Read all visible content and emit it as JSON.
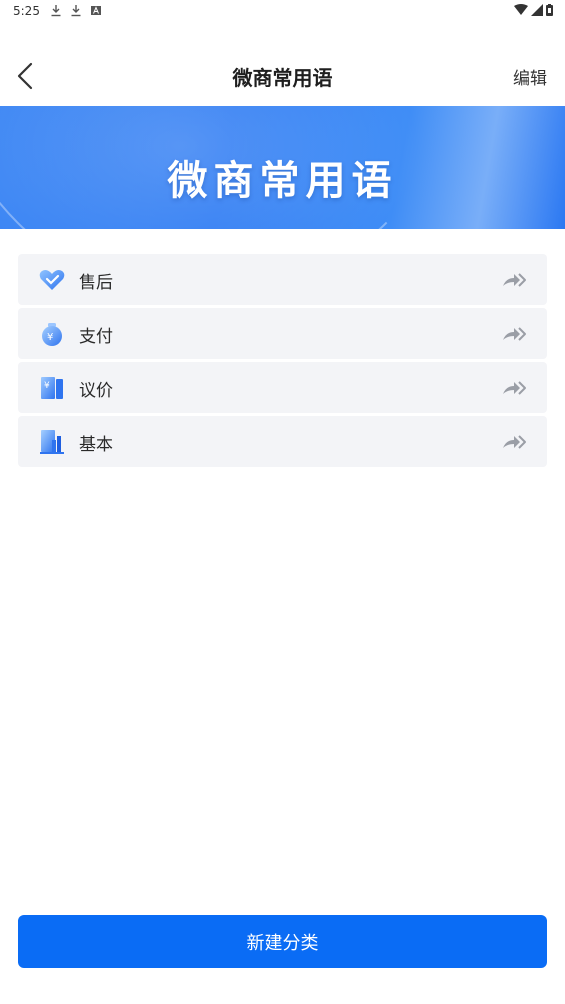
{
  "status_bar": {
    "time": "5:25",
    "left_icons": [
      "download-icon",
      "download-icon",
      "a-box-icon"
    ],
    "right_icons": [
      "wifi-icon",
      "signal-icon",
      "battery-icon"
    ]
  },
  "header": {
    "back_icon": "chevron-left-icon",
    "title": "微商常用语",
    "edit_label": "编辑"
  },
  "banner": {
    "title": "微商常用语"
  },
  "categories": [
    {
      "label": "售后",
      "icon": "heart-check-icon"
    },
    {
      "label": "支付",
      "icon": "money-bag-icon"
    },
    {
      "label": "议价",
      "icon": "price-tag-icon"
    },
    {
      "label": "基本",
      "icon": "document-chart-icon"
    }
  ],
  "footer": {
    "new_category_label": "新建分类"
  },
  "colors": {
    "accent": "#0a6cf5",
    "banner": "#3c86f4",
    "list_bg": "#f3f4f7"
  }
}
